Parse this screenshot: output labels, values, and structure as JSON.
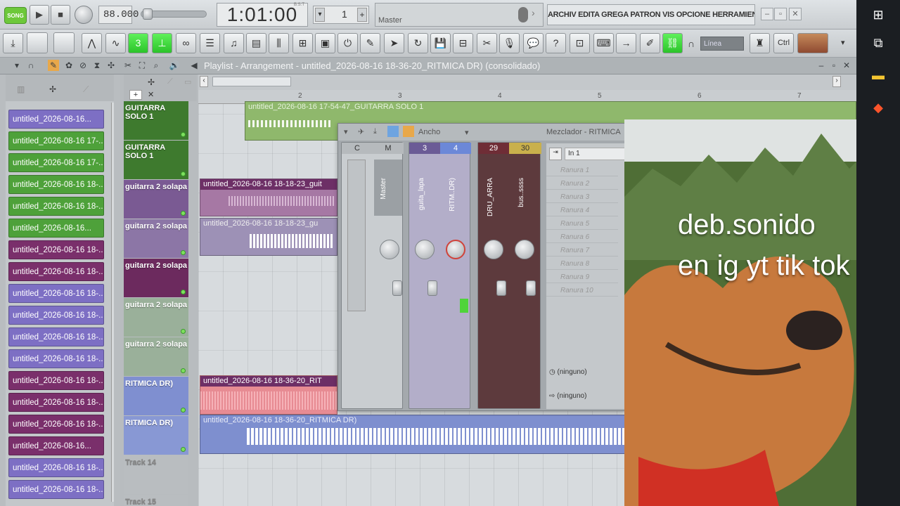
{
  "transport": {
    "song_label": "SONG",
    "tempo": "88.000",
    "time": "1:01:00",
    "time_sub": "B:S:T",
    "pattern": "1",
    "hint": "Master",
    "menu": "ARCHIV EDITA GREGA PATRON VIS OPCIONE HERRAMIENTA"
  },
  "toolbar": {
    "snap": "Línea",
    "ctrl": "Ctrl"
  },
  "playlist": {
    "title": "Playlist - Arrangement - untitled_2026-08-16 18-36-20_RITMICA DR) (consolidado)",
    "bar_numbers": [
      "2",
      "3",
      "4",
      "5",
      "6",
      "7"
    ]
  },
  "clips": [
    {
      "label": "untitled_2026-08-16...",
      "color": "#7d6fc4"
    },
    {
      "label": "untitled_2026-08-16 17-...",
      "color": "#4ea13a"
    },
    {
      "label": "untitled_2026-08-16 17-...",
      "color": "#4ea13a"
    },
    {
      "label": "untitled_2026-08-16 18-...",
      "color": "#4ea13a"
    },
    {
      "label": "untitled_2026-08-16 18-...",
      "color": "#4ea13a"
    },
    {
      "label": "untitled_2026-08-16...",
      "color": "#4ea13a"
    },
    {
      "label": "untitled_2026-08-16 18-...",
      "color": "#7a2f6b"
    },
    {
      "label": "untitled_2026-08-16 18-...",
      "color": "#7a2f6b"
    },
    {
      "label": "untitled_2026-08-16 18-...",
      "color": "#7d6fc4"
    },
    {
      "label": "untitled_2026-08-16 18-...",
      "color": "#7d6fc4"
    },
    {
      "label": "untitled_2026-08-16 18-...",
      "color": "#7d6fc4"
    },
    {
      "label": "untitled_2026-08-16 18-...",
      "color": "#7d6fc4"
    },
    {
      "label": "untitled_2026-08-16 18-...",
      "color": "#7a2f6b"
    },
    {
      "label": "untitled_2026-08-16 18-...",
      "color": "#7a2f6b"
    },
    {
      "label": "untitled_2026-08-16 18-...",
      "color": "#7a2f6b"
    },
    {
      "label": "untitled_2026-08-16...",
      "color": "#7a2f6b"
    },
    {
      "label": "untitled_2026-08-16 18-...",
      "color": "#7d6fc4"
    },
    {
      "label": "untitled_2026-08-16 18-...",
      "color": "#7d6fc4"
    }
  ],
  "tracks": [
    {
      "label": "GUITARRA SOLO 1",
      "color": "#3e7a2e"
    },
    {
      "label": "GUITARRA SOLO 1",
      "color": "#3e7a2e"
    },
    {
      "label": "guitarra 2 solapa",
      "color": "#7a5a93"
    },
    {
      "label": "guitarra 2 solapa",
      "color": "#8c76a6"
    },
    {
      "label": "guitarra 2 solapa",
      "color": "#6c2a5e"
    },
    {
      "label": "guitarra 2 solapa",
      "color": "#9ab09a"
    },
    {
      "label": "guitarra 2 solapa",
      "color": "#9ab09a"
    },
    {
      "label": "RITMICA DR)",
      "color": "#7f8fd0"
    },
    {
      "label": "RITMICA DR)",
      "color": "#8898d4"
    },
    {
      "label": "Track 14",
      "color": "#b9bdc0"
    },
    {
      "label": "Track 15",
      "color": "#b9bdc0"
    }
  ],
  "pattern_clips": {
    "solo": "untitled_2026-08-16 17-54-47_GUITARRA SOLO 1",
    "solapa1": "untitled_2026-08-16 18-18-23_guit",
    "solapa2": "untitled_2026-08-16 18-18-23_gu",
    "ritmica1": "untitled_2026-08-16 18-36-20_RIT",
    "ritmica2": "untitled_2026-08-16 18-36-20_RITMICA DR)"
  },
  "mixer": {
    "mode": "Ancho",
    "title": "Mezclador - RITMICA",
    "strips": [
      {
        "head": "C",
        "name": ""
      },
      {
        "head": "M",
        "name": "Master"
      },
      {
        "head": "3",
        "name": "guita_lapa"
      },
      {
        "head": "4",
        "name": "RITM..DR)"
      },
      {
        "head": "29",
        "name": "DRU_ARRA"
      },
      {
        "head": "30",
        "name": "bus..ssss"
      }
    ],
    "input": "In 1",
    "slots": [
      "Ranura 1",
      "Ranura 2",
      "Ranura 3",
      "Ranura 4",
      "Ranura 5",
      "Ranura 6",
      "Ranura 7",
      "Ranura 8",
      "Ranura 9",
      "Ranura 10"
    ],
    "none1": "(ninguno)",
    "none2": "(ninguno)"
  },
  "overlay": {
    "line1": "deb.sonido",
    "line2": "en ig yt tik tok"
  }
}
